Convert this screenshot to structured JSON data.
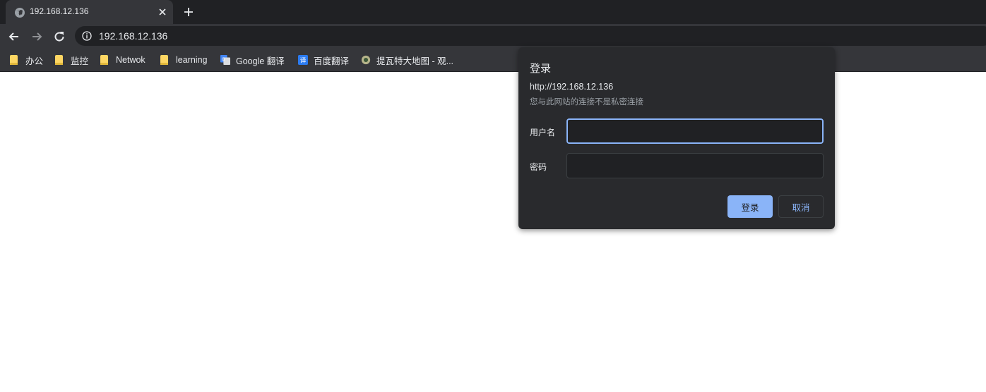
{
  "tab": {
    "title": "192.168.12.136",
    "icon": "globe-icon",
    "close_icon": "close-icon",
    "new_tab_icon": "plus-icon"
  },
  "toolbar": {
    "back_icon": "arrow-left-icon",
    "forward_icon": "arrow-right-icon",
    "reload_icon": "reload-icon",
    "site_info_icon": "info-icon",
    "url": "192.168.12.136"
  },
  "bookmarks": [
    {
      "label": "办公",
      "icon": "folder-icon"
    },
    {
      "label": "监控",
      "icon": "folder-icon"
    },
    {
      "label": "Netwok",
      "icon": "folder-icon"
    },
    {
      "label": "learning",
      "icon": "folder-icon"
    },
    {
      "label": "Google 翻译",
      "icon": "google-translate-icon"
    },
    {
      "label": "百度翻译",
      "icon": "baidu-translate-icon"
    },
    {
      "label": "提瓦特大地图 - 观...",
      "icon": "map-site-icon"
    }
  ],
  "dialog": {
    "title": "登录",
    "origin": "http://192.168.12.136",
    "warning": "您与此网站的连接不是私密连接",
    "username_label": "用户名",
    "username_value": "",
    "password_label": "密码",
    "password_value": "",
    "submit_label": "登录",
    "cancel_label": "取消"
  },
  "colors": {
    "accent": "#8ab4f8",
    "chrome_dark": "#202124",
    "chrome_toolbar": "#35363a",
    "dialog_bg": "#292a2d",
    "folder": "#fdd663"
  }
}
